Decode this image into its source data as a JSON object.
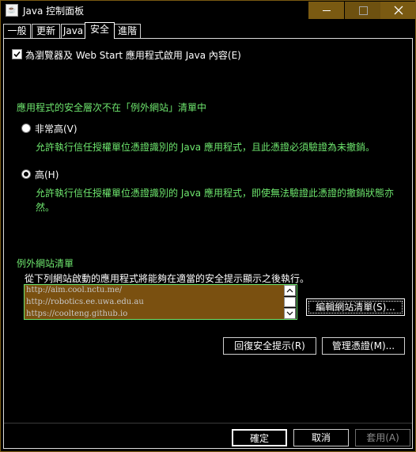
{
  "window": {
    "title": "Java 控制面板",
    "app_icon_glyph": "☕",
    "colors": {
      "accent": "#7a5a12",
      "text_green": "#6ee66e",
      "background": "#000000",
      "list_bg": "#7a5010"
    }
  },
  "tabs": [
    {
      "label": "一般",
      "active": false
    },
    {
      "label": "更新",
      "active": false
    },
    {
      "label": "Java",
      "active": false
    },
    {
      "label": "安全",
      "active": true
    },
    {
      "label": "進階",
      "active": false
    }
  ],
  "security": {
    "enable_checkbox_label": "為瀏覽器及 Web Start 應用程式啟用 Java 內容(E)",
    "enable_checked": true,
    "level_section_title": "應用程式的安全層次不在「例外網站」清單中",
    "levels": [
      {
        "label": "非常高(V)",
        "selected": false,
        "description": "允許執行信任授權單位憑證識別的 Java 應用程式，且此憑證必須驗證為未撤銷。"
      },
      {
        "label": "高(H)",
        "selected": true,
        "description": "允許執行信任授權單位憑證識別的 Java 應用程式，即使無法驗證此憑證的撤銷狀態亦然。"
      }
    ],
    "exception_site_title": "例外網站清單",
    "exception_site_desc": "從下列網站啟動的應用程式將能夠在適當的安全提示顯示之後執行。",
    "exception_sites": [
      "http://aim.cool.nctu.me/",
      "http://robotics.ee.uwa.edu.au",
      "https://coolteng.github.io"
    ],
    "edit_site_list_button": "編輯網站清單(S)...",
    "restore_prompts_button": "回復安全提示(R)",
    "manage_certificates_button": "管理憑證(M)..."
  },
  "footer": {
    "ok_button": "確定",
    "cancel_button": "取消",
    "apply_button": "套用(A)"
  }
}
